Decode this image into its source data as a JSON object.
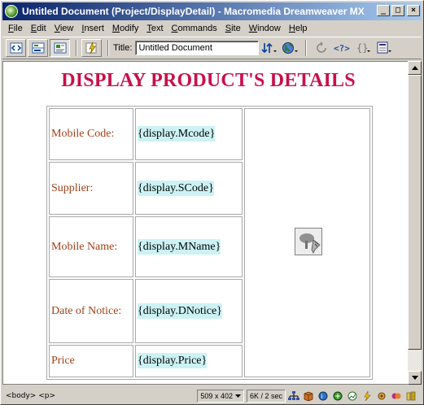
{
  "window": {
    "title": "Untitled Document (Project/DisplayDetail) - Macromedia Dreamweaver MX",
    "minimize_label": "_",
    "maximize_label": "□",
    "close_label": "×"
  },
  "menu": {
    "items": [
      {
        "first": "F",
        "rest": "ile"
      },
      {
        "first": "E",
        "rest": "dit"
      },
      {
        "first": "V",
        "rest": "iew"
      },
      {
        "first": "I",
        "rest": "nsert"
      },
      {
        "first": "M",
        "rest": "odify"
      },
      {
        "first": "T",
        "rest": "ext"
      },
      {
        "first": "C",
        "rest": "ommands"
      },
      {
        "first": "S",
        "rest": "ite"
      },
      {
        "first": "W",
        "rest": "indow"
      },
      {
        "first": "H",
        "rest": "elp"
      }
    ]
  },
  "toolbar": {
    "title_label": "Title:",
    "title_value": "Untitled Document"
  },
  "document": {
    "heading": "DISPLAY PRODUCT'S DETAILS",
    "rows": [
      {
        "label": "Mobile Code:",
        "binding": "{display.Mcode}"
      },
      {
        "label": "Supplier:",
        "binding": "{display.SCode}"
      },
      {
        "label": "Mobile Name:",
        "binding": "{display.MName}"
      },
      {
        "label": "Date of Notice:",
        "binding": "{display.DNotice}"
      },
      {
        "label": "Price",
        "binding": "{display.Price}"
      }
    ]
  },
  "statusbar": {
    "tag_selector": "<body> <p>",
    "window_size": "509 x 402",
    "download": "6K / 2 sec"
  },
  "colors": {
    "heading": "#c8104a",
    "label": "#a0401a",
    "binding_highlight": "#ccf2f4",
    "titlebar_start": "#0a246a",
    "titlebar_end": "#a6caf0"
  }
}
